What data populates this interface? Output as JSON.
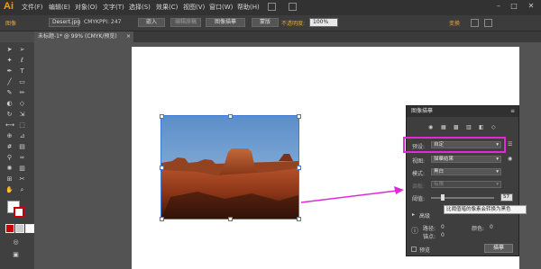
{
  "app": {
    "logo": "Ai"
  },
  "menu": [
    "文件(F)",
    "编辑(E)",
    "对象(O)",
    "文字(T)",
    "选择(S)",
    "效果(C)",
    "视图(V)",
    "窗口(W)",
    "帮助(H)"
  ],
  "control_bar": {
    "kind": "图像",
    "filename": "Desert.jpg",
    "color_mode": "CMYK",
    "ppi": "PPI: 247",
    "embed_button": "嵌入",
    "edit_original_button": "编辑原稿",
    "image_trace_button": "图像描摹",
    "mask_button": "蒙版",
    "opacity_label": "不透明度:",
    "opacity_value": "100%",
    "transform_label": "变换"
  },
  "document": {
    "tab_title": "未标题-1* @ 99% (CMYK/预览)",
    "close": "×"
  },
  "panel": {
    "title": "图像描摹",
    "preset_label": "预设:",
    "preset_value": "自定",
    "view_label": "视图:",
    "view_value": "描摹结果",
    "mode_label": "模式:",
    "mode_value": "黑白",
    "palette_label": "调板:",
    "palette_value": "有限",
    "threshold_label": "阈值:",
    "threshold_value": "57",
    "advanced_label": "高级",
    "paths_label": "路径:",
    "paths_value": "0",
    "anchors_label": "锚点:",
    "anchors_value": "0",
    "colors_label": "颜色:",
    "colors_value": "0",
    "preview_label": "预览",
    "trace_button": "描摹",
    "tooltip": "比阈值暗的像素会转换为黑色"
  },
  "colors": {
    "highlight": "#e02ad8",
    "accent": "#ff9a00"
  }
}
